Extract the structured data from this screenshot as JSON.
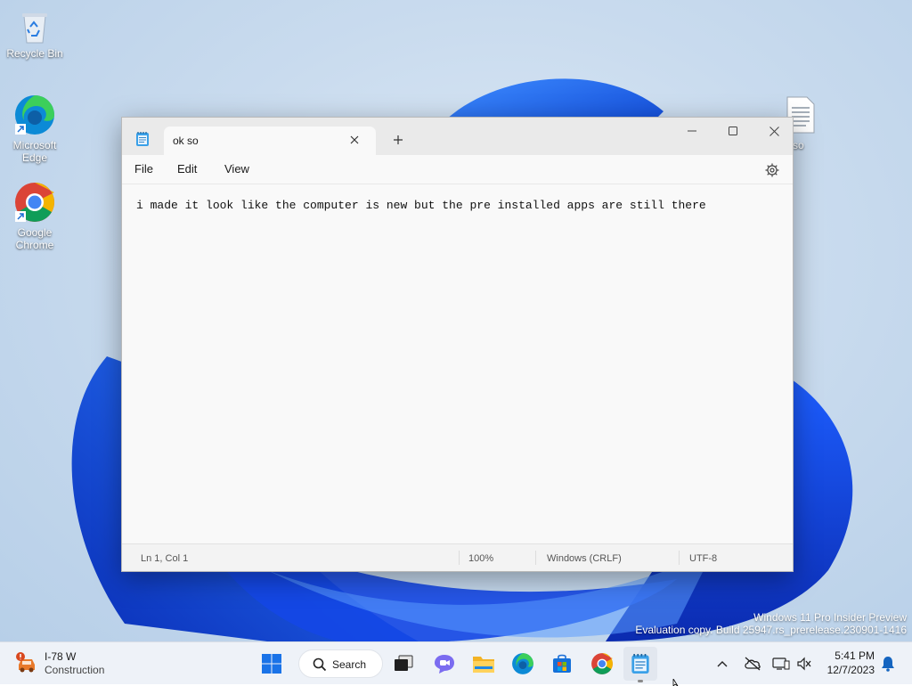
{
  "desktop": {
    "icons": [
      {
        "label": "Recycle Bin"
      },
      {
        "label": "Microsoft Edge"
      },
      {
        "label": "Google Chrome"
      }
    ],
    "hidden_file_label": "ok so",
    "watermark": {
      "line1": "Windows 11 Pro Insider Preview",
      "line2": "Evaluation copy. Build 25947.rs_prerelease.230901-1416"
    }
  },
  "notepad": {
    "tab_title": "ok so",
    "menu": [
      "File",
      "Edit",
      "View"
    ],
    "content": "i made it look like the computer is new but the pre installed apps are still there",
    "status": {
      "position": "Ln 1, Col 1",
      "zoom": "100%",
      "line_ending": "Windows (CRLF)",
      "encoding": "UTF-8"
    }
  },
  "taskbar": {
    "weather": {
      "title": "I-78 W",
      "subtitle": "Construction",
      "icon": "traffic-warning-icon"
    },
    "search_label": "Search",
    "pinned": [
      "start",
      "task-view",
      "chat",
      "file-explorer",
      "edge",
      "store",
      "chrome",
      "notepad"
    ],
    "clock": {
      "time": "5:41 PM",
      "date": "12/7/2023"
    },
    "accent": "#0067c0"
  }
}
